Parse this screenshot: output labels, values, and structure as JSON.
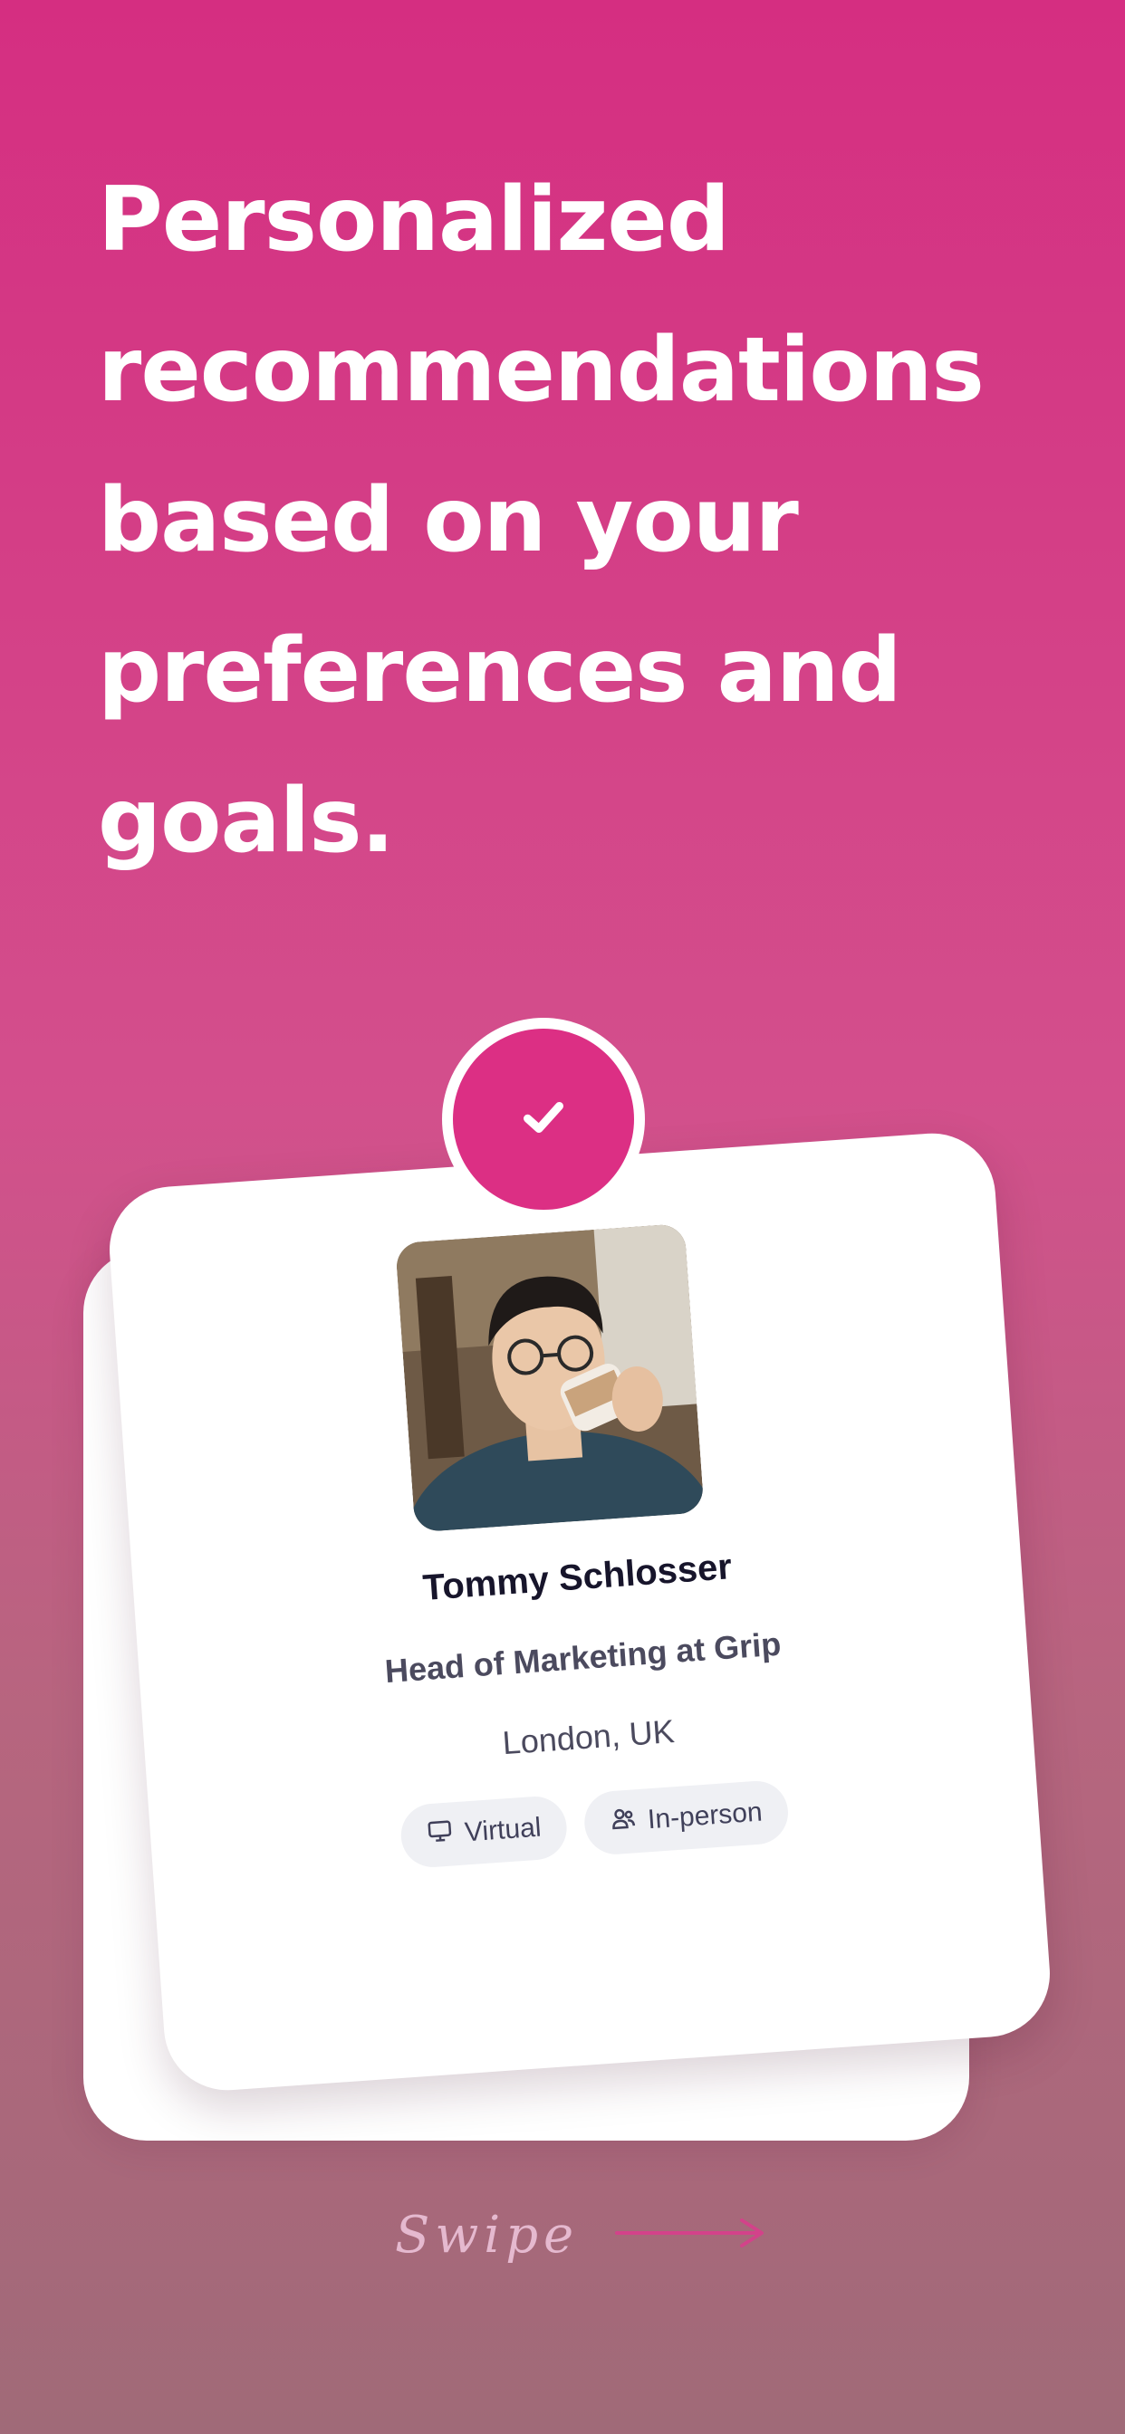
{
  "headline": "Personalized recommendations based on your preferences and goals.",
  "profile": {
    "name": "Tommy Schlosser",
    "role": "Head of Marketing at Grip",
    "location": "London, UK",
    "tags": [
      "Virtual",
      "In-person"
    ]
  },
  "swipe_label": "Swipe",
  "colors": {
    "accent": "#dc2f84",
    "gradient_top": "#d52e81",
    "gradient_bottom": "#a06a78"
  },
  "icons": {
    "badge": "check-icon",
    "virtual": "monitor-icon",
    "in_person": "people-icon",
    "swipe": "arrow-right-icon"
  }
}
